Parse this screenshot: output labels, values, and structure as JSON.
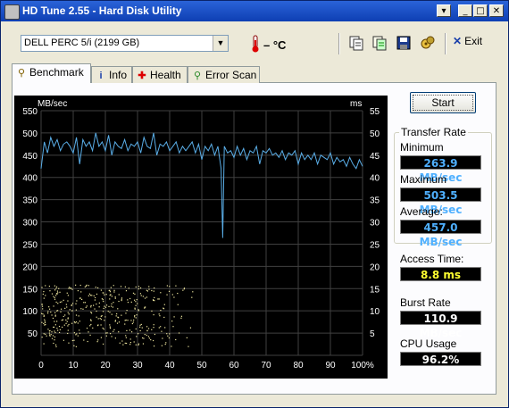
{
  "window": {
    "title": "HD Tune 2.55 - Hard Disk Utility"
  },
  "toolbar": {
    "drive": "DELL    PERC 5/i (2199 GB)",
    "temperature": "– °C",
    "exit_label": "Exit"
  },
  "tabs": [
    {
      "label": "Benchmark",
      "icon": "benchmark-icon",
      "active": true
    },
    {
      "label": "Info",
      "icon": "info-icon"
    },
    {
      "label": "Health",
      "icon": "health-icon"
    },
    {
      "label": "Error Scan",
      "icon": "error-scan-icon"
    }
  ],
  "start_label": "Start",
  "transfer_rate": {
    "title": "Transfer Rate",
    "minimum_label": "Minimum",
    "minimum": "263.9 MB/sec",
    "maximum_label": "Maximum",
    "maximum": "503.5 MB/sec",
    "average_label": "Average:",
    "average": "457.0 MB/sec"
  },
  "access_time": {
    "label": "Access Time:",
    "value": "8.8 ms"
  },
  "burst_rate": {
    "label": "Burst Rate",
    "value": "110.9 MB/sec"
  },
  "cpu_usage": {
    "label": "CPU Usage",
    "value": "96.2%"
  },
  "colors": {
    "line": "#5aaee8",
    "scatter": "#f0e8a0",
    "grid": "#404040",
    "value_blue": "#4fb0ff",
    "value_yellow": "#ffff30"
  },
  "chart_data": {
    "type": "line",
    "left_axis_unit": "MB/sec",
    "right_axis_unit": "ms",
    "left_ticks": [
      "550",
      "500",
      "450",
      "400",
      "350",
      "300",
      "250",
      "200",
      "150",
      "100",
      "50"
    ],
    "right_ticks": [
      "55",
      "50",
      "45",
      "40",
      "35",
      "30",
      "25",
      "20",
      "15",
      "10",
      "5"
    ],
    "x_ticks": [
      "0",
      "10",
      "20",
      "30",
      "40",
      "50",
      "60",
      "70",
      "80",
      "90",
      "100%"
    ],
    "xlim": [
      0,
      100
    ],
    "ylim": [
      0,
      550
    ],
    "y2lim": [
      0,
      55
    ],
    "grid": true,
    "series": [
      {
        "type": "line",
        "x": [
          0,
          1,
          2,
          3,
          4,
          5,
          6,
          7,
          8,
          9,
          10,
          11,
          12,
          13,
          14,
          15,
          16,
          17,
          18,
          19,
          20,
          21,
          22,
          23,
          24,
          25,
          26,
          27,
          28,
          29,
          30,
          31,
          32,
          33,
          34,
          35,
          36,
          37,
          38,
          39,
          40,
          41,
          42,
          43,
          44,
          45,
          46,
          47,
          48,
          49,
          50,
          51,
          52,
          53,
          54,
          55,
          56,
          56.5,
          57,
          58,
          59,
          60,
          61,
          62,
          63,
          64,
          65,
          66,
          67,
          68,
          69,
          70,
          71,
          72,
          73,
          74,
          75,
          76,
          77,
          78,
          79,
          80,
          81,
          82,
          83,
          84,
          85,
          86,
          87,
          88,
          89,
          90,
          91,
          92,
          93,
          94,
          95,
          96,
          97,
          98,
          99,
          100
        ],
        "y": [
          420,
          480,
          455,
          490,
          470,
          485,
          460,
          475,
          480,
          470,
          455,
          490,
          430,
          485,
          470,
          480,
          460,
          500,
          470,
          480,
          460,
          495,
          450,
          480,
          470,
          465,
          485,
          460,
          475,
          470,
          480,
          455,
          490,
          470,
          465,
          500,
          450,
          475,
          470,
          480,
          460,
          470,
          480,
          455,
          470,
          460,
          470,
          480,
          455,
          475,
          440,
          470,
          460,
          475,
          450,
          470,
          420,
          263.9,
          470,
          455,
          460,
          445,
          470,
          450,
          465,
          440,
          460,
          455,
          470,
          430,
          460,
          455,
          465,
          450,
          455,
          445,
          460,
          440,
          455,
          450,
          460,
          430,
          455,
          440,
          450,
          440,
          455,
          430,
          450,
          445,
          440,
          455,
          430,
          445,
          435,
          440,
          425,
          445,
          430,
          420,
          440,
          425
        ]
      },
      {
        "type": "scatter",
        "name": "access time",
        "range_ms": [
          2,
          16
        ],
        "x_range": [
          0,
          50
        ]
      }
    ]
  }
}
